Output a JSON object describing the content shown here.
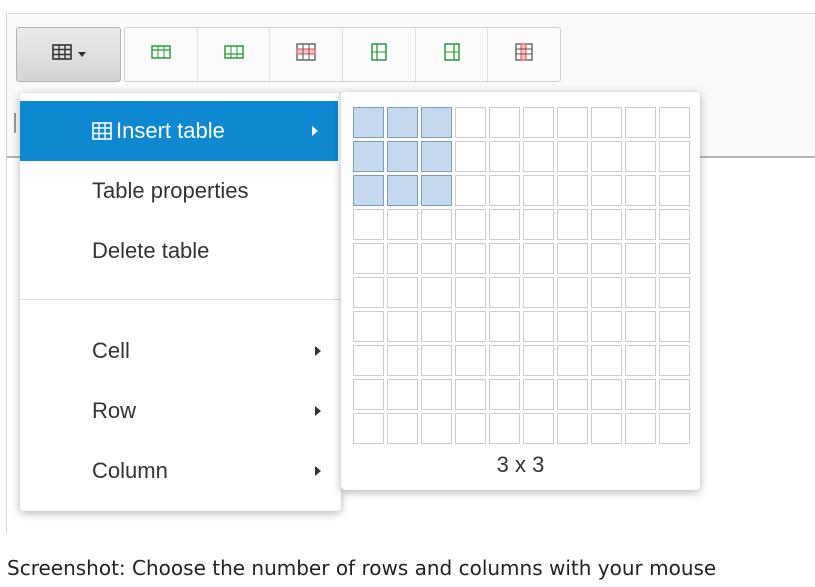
{
  "toolbar": {
    "table_button_icon": "table-icon",
    "buttons": [
      {
        "icon": "insert-row-before-icon",
        "color": "#2b9b3a"
      },
      {
        "icon": "insert-row-after-icon",
        "color": "#2b9b3a"
      },
      {
        "icon": "delete-row-icon",
        "color": "#e24f4f"
      },
      {
        "icon": "insert-column-before-icon",
        "color": "#2b9b3a"
      },
      {
        "icon": "insert-column-after-icon",
        "color": "#2b9b3a"
      },
      {
        "icon": "delete-column-icon",
        "color": "#e24f4f"
      }
    ]
  },
  "menu": {
    "items": [
      {
        "label": "Insert table",
        "icon": "table-icon",
        "has_submenu": true,
        "active": true
      },
      {
        "label": "Table properties",
        "has_submenu": false
      },
      {
        "label": "Delete table",
        "has_submenu": false
      },
      {
        "label": "Cell",
        "has_submenu": true
      },
      {
        "label": "Row",
        "has_submenu": true
      },
      {
        "label": "Column",
        "has_submenu": true
      }
    ]
  },
  "grid_picker": {
    "rows": 10,
    "columns": 10,
    "selected_rows": 3,
    "selected_columns": 3,
    "size_label": "3 x 3"
  },
  "caption": "Screenshot: Choose the number of rows and columns with your mouse",
  "colors": {
    "accent": "#0e88d1",
    "selected_cell": "#c5d9ef",
    "insert_icon": "#2b9b3a",
    "delete_icon": "#e24f4f"
  }
}
